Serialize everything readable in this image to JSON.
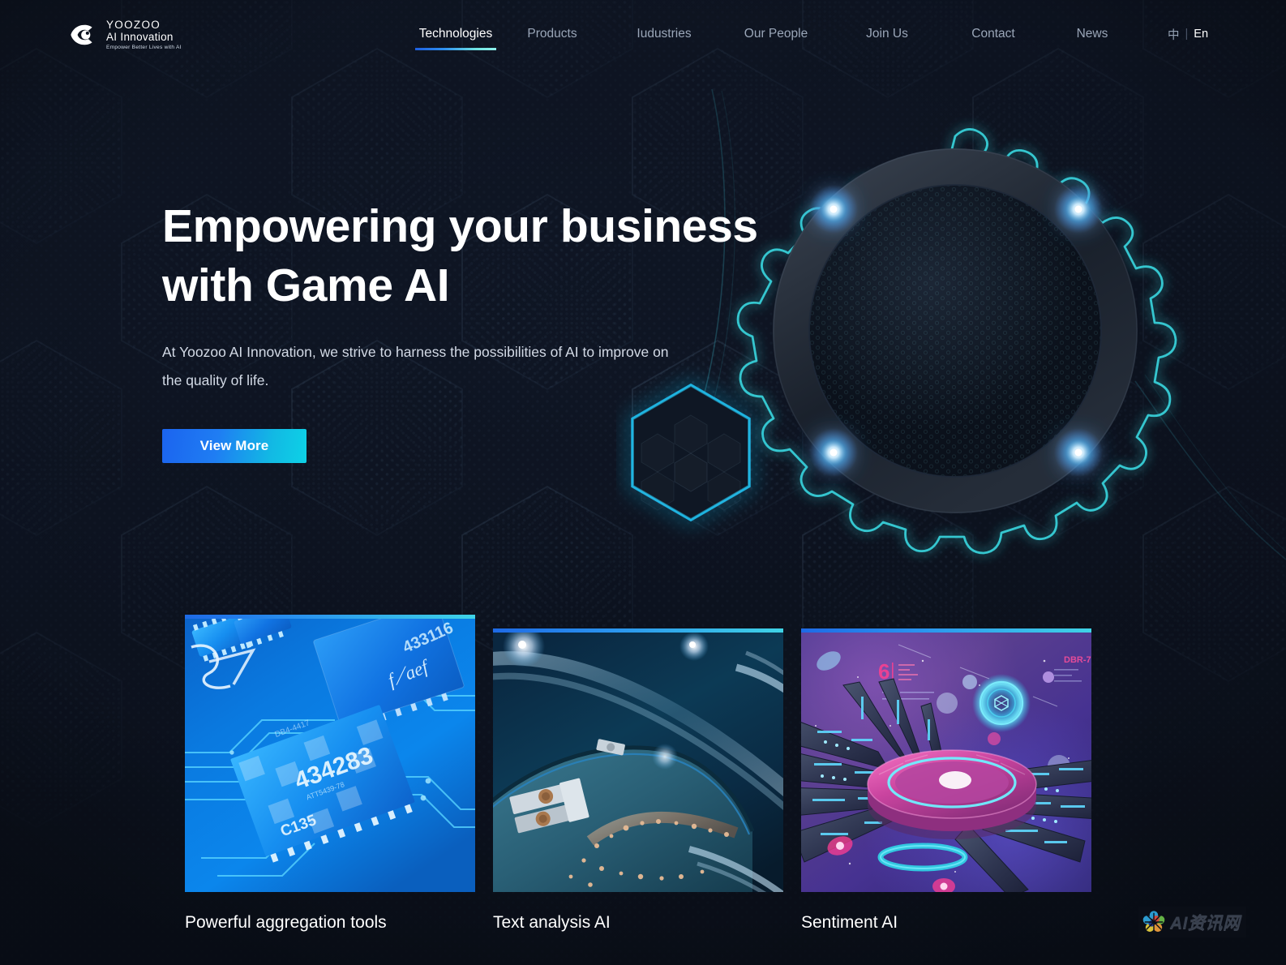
{
  "site": {
    "logo": {
      "icon": "eye-logo-icon",
      "line1": "YOOZOO",
      "line2": "AI Innovation",
      "tagline": "Empower Better Lives with AI"
    },
    "nav": {
      "items": [
        {
          "label": "Technologies",
          "active": true
        },
        {
          "label": "Products",
          "active": false
        },
        {
          "label": "Iudustries",
          "active": false
        },
        {
          "label": "Our People",
          "active": false
        },
        {
          "label": "Join Us",
          "active": false
        },
        {
          "label": "Contact",
          "active": false
        },
        {
          "label": "News",
          "active": false
        }
      ]
    },
    "language": {
      "chinese": "中",
      "separator": "|",
      "english": "En",
      "active": "En"
    }
  },
  "hero": {
    "title_line1": "Empowering your business",
    "title_line2": "with Game AI",
    "subtitle": "At Yoozoo AI Innovation, we strive to harness the possibilities of AI to improve on the quality of life.",
    "cta_label": "View More",
    "art": {
      "gear_icon": "glowing-gear-icon",
      "hexagon_icon": "glowing-hexagon-icon"
    }
  },
  "cards": [
    {
      "title": "Powerful aggregation tools",
      "image_alt": "blue-circuit-board-microchip-image"
    },
    {
      "title": "Text analysis AI",
      "image_alt": "dark-teal-metallic-arc-image"
    },
    {
      "title": "Sentiment AI",
      "image_alt": "purple-sci-fi-spacecraft-image"
    }
  ],
  "watermark": {
    "text": "AI资讯网",
    "icon": "pinwheel-flower-icon"
  },
  "colors": {
    "page_bg": "#0e1422",
    "accent_blue": "#1b64ef",
    "accent_cyan": "#0dd2e6",
    "text_primary": "#ffffff",
    "text_muted": "#9aa6b8"
  }
}
